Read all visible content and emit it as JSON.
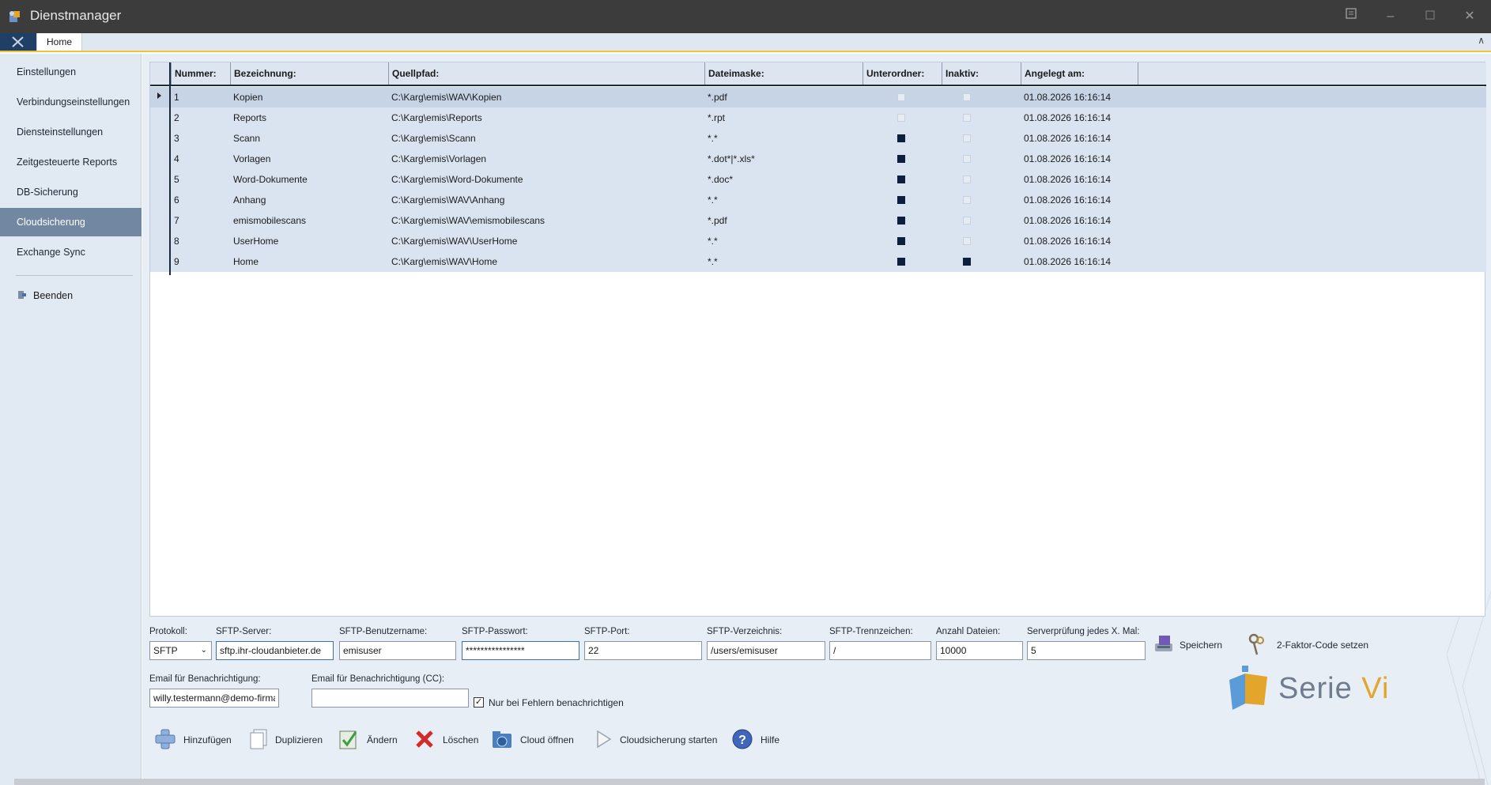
{
  "window": {
    "title": "Dienstmanager"
  },
  "ribbon": {
    "tab_home": "Home"
  },
  "sidebar": {
    "items": [
      {
        "label": "Einstellungen"
      },
      {
        "label": "Verbindungseinstellungen"
      },
      {
        "label": "Diensteinstellungen"
      },
      {
        "label": "Zeitgesteuerte Reports"
      },
      {
        "label": "DB-Sicherung"
      },
      {
        "label": "Cloudsicherung",
        "active": true
      },
      {
        "label": "Exchange Sync"
      }
    ],
    "exit_label": "Beenden"
  },
  "grid": {
    "headers": [
      "Nummer:",
      "Bezeichnung:",
      "Quellpfad:",
      "Dateimaske:",
      "Unterordner:",
      "Inaktiv:",
      "Angelegt am:"
    ],
    "rows": [
      {
        "nr": "1",
        "name": "Kopien",
        "path": "C:\\Karg\\emis\\WAV\\Kopien",
        "mask": "*.pdf",
        "sub": false,
        "inactive": false,
        "created": "01.08.2026 16:16:14"
      },
      {
        "nr": "2",
        "name": "Reports",
        "path": "C:\\Karg\\emis\\Reports",
        "mask": "*.rpt",
        "sub": false,
        "inactive": false,
        "created": "01.08.2026 16:16:14"
      },
      {
        "nr": "3",
        "name": "Scann",
        "path": "C:\\Karg\\emis\\Scann",
        "mask": "*.*",
        "sub": true,
        "inactive": false,
        "created": "01.08.2026 16:16:14"
      },
      {
        "nr": "4",
        "name": "Vorlagen",
        "path": "C:\\Karg\\emis\\Vorlagen",
        "mask": "*.dot*|*.xls*",
        "sub": true,
        "inactive": false,
        "created": "01.08.2026 16:16:14"
      },
      {
        "nr": "5",
        "name": "Word-Dokumente",
        "path": "C:\\Karg\\emis\\Word-Dokumente",
        "mask": "*.doc*",
        "sub": true,
        "inactive": false,
        "created": "01.08.2026 16:16:14"
      },
      {
        "nr": "6",
        "name": "Anhang",
        "path": "C:\\Karg\\emis\\WAV\\Anhang",
        "mask": "*.*",
        "sub": true,
        "inactive": false,
        "created": "01.08.2026 16:16:14"
      },
      {
        "nr": "7",
        "name": "emismobilescans",
        "path": "C:\\Karg\\emis\\WAV\\emismobilescans",
        "mask": "*.pdf",
        "sub": true,
        "inactive": false,
        "created": "01.08.2026 16:16:14"
      },
      {
        "nr": "8",
        "name": "UserHome",
        "path": "C:\\Karg\\emis\\WAV\\UserHome",
        "mask": "*.*",
        "sub": true,
        "inactive": false,
        "created": "01.08.2026 16:16:14"
      },
      {
        "nr": "9",
        "name": "Home",
        "path": "C:\\Karg\\emis\\WAV\\Home",
        "mask": "*.*",
        "sub": true,
        "inactive": true,
        "created": "01.08.2026 16:16:14"
      }
    ]
  },
  "form": {
    "protokoll_label": "Protokoll:",
    "protokoll_value": "SFTP",
    "server_label": "SFTP-Server:",
    "server_value": "sftp.ihr-cloudanbieter.de",
    "user_label": "SFTP-Benutzername:",
    "user_value": "emisuser",
    "password_label": "SFTP-Passwort:",
    "password_value": "****************",
    "port_label": "SFTP-Port:",
    "port_value": "22",
    "dir_label": "SFTP-Verzeichnis:",
    "dir_value": "/users/emisuser",
    "sep_label": "SFTP-Trennzeichen:",
    "sep_value": "/",
    "count_label": "Anzahl Dateien:",
    "count_value": "10000",
    "check_label": "Serverprüfung jedes X. Mal:",
    "check_value": "5",
    "save_label": "Speichern",
    "twofa_label": "2-Faktor-Code setzen",
    "email_label": "Email für Benachrichtigung:",
    "email_value": "willy.testermann@demo-firma.de",
    "email_cc_label": "Email für Benachrichtigung (CC):",
    "email_cc_value": "",
    "errors_only_label": "Nur bei Fehlern benachrichtigen",
    "errors_only_checked": true
  },
  "toolbar": {
    "add": "Hinzufügen",
    "duplicate": "Duplizieren",
    "edit": "Ändern",
    "delete": "Löschen",
    "open_cloud": "Cloud öffnen",
    "start": "Cloudsicherung starten",
    "help": "Hilfe"
  },
  "logo": {
    "brand": "Serie ",
    "brand_accent": "Vi"
  },
  "colors": {
    "accent": "#f0c43a",
    "sidebar_active": "#7287a2",
    "checkbox_on": "#0c1f3f"
  }
}
